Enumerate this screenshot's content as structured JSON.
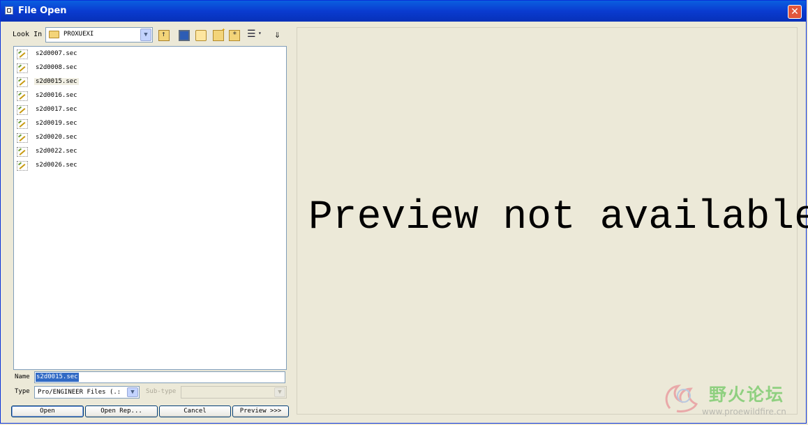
{
  "window": {
    "title": "File Open"
  },
  "toolbar": {
    "look_in_label": "Look In",
    "look_in_value": "PROXUEXI"
  },
  "files": [
    {
      "name": "s2d0007.sec"
    },
    {
      "name": "s2d0008.sec"
    },
    {
      "name": "s2d0015.sec",
      "selected": true
    },
    {
      "name": "s2d0016.sec"
    },
    {
      "name": "s2d0017.sec"
    },
    {
      "name": "s2d0019.sec"
    },
    {
      "name": "s2d0020.sec"
    },
    {
      "name": "s2d0022.sec"
    },
    {
      "name": "s2d0026.sec"
    }
  ],
  "name_field": {
    "label": "Name",
    "value": "s2d0015.sec"
  },
  "type_field": {
    "label": "Type",
    "value": "Pro/ENGINEER Files (.:"
  },
  "subtype_field": {
    "label": "Sub-type",
    "value": ""
  },
  "buttons": {
    "open": "Open",
    "open_rep": "Open Rep...",
    "cancel": "Cancel",
    "preview": "Preview >>>"
  },
  "preview": {
    "message": "Preview not available."
  },
  "watermark": {
    "text": "野火论坛",
    "url": "www.proewildfire.cn"
  }
}
